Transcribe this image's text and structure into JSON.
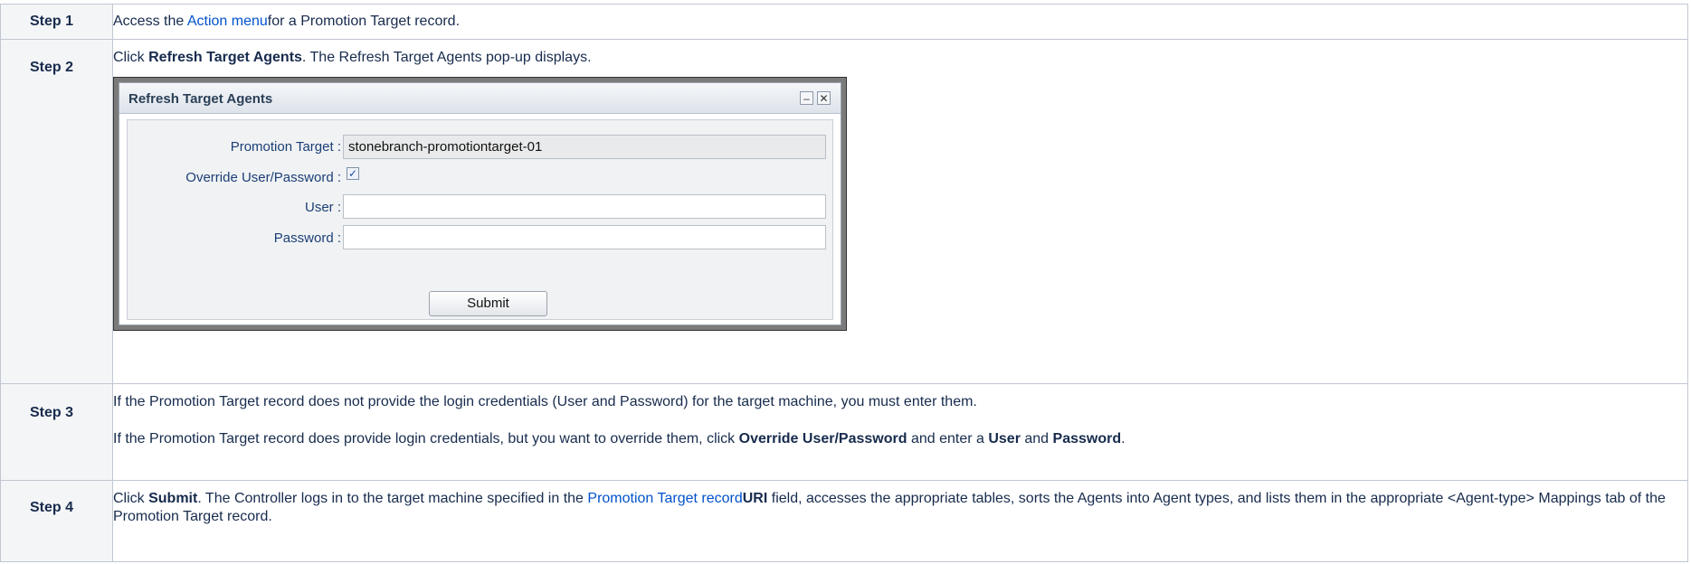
{
  "steps": [
    {
      "label": "Step 1",
      "text_pre": "Access the ",
      "link": "Action menu",
      "text_post": "for a Promotion Target record."
    },
    {
      "label": "Step 2",
      "pre": "Click ",
      "bold": "Refresh Target Agents",
      "post": ". The Refresh Target Agents pop-up displays."
    },
    {
      "label": "Step 3",
      "p1": "If the Promotion Target record does not provide the login credentials (User and Password) for the target machine, you must enter them.",
      "p2_pre": "If the Promotion Target record does provide login credentials, but you want to override them, click ",
      "p2_b1": "Override User/Password",
      "p2_mid": " and enter a ",
      "p2_b2": "User",
      "p2_and": " and ",
      "p2_b3": "Password",
      "p2_end": "."
    },
    {
      "label": "Step 4",
      "pre": "Click ",
      "b1": "Submit",
      "mid": ". The Controller logs in to the target machine specified in the ",
      "link": "Promotion Target record",
      "b2": "URI",
      "post": " field, accesses the appropriate tables, sorts the Agents into Agent types, and lists them in the appropriate <Agent-type> Mappings tab of the Promotion Target record."
    }
  ],
  "dialog": {
    "title": "Refresh Target Agents",
    "minimize_glyph": "–",
    "close_glyph": "✕",
    "fields": {
      "promotion_target_label": "Promotion Target :",
      "promotion_target_value": "stonebranch-promotiontarget-01",
      "override_label": "Override User/Password :",
      "override_checked_glyph": "✓",
      "user_label": "User :",
      "user_value": "",
      "password_label": "Password :",
      "password_value": ""
    },
    "submit_label": "Submit"
  }
}
